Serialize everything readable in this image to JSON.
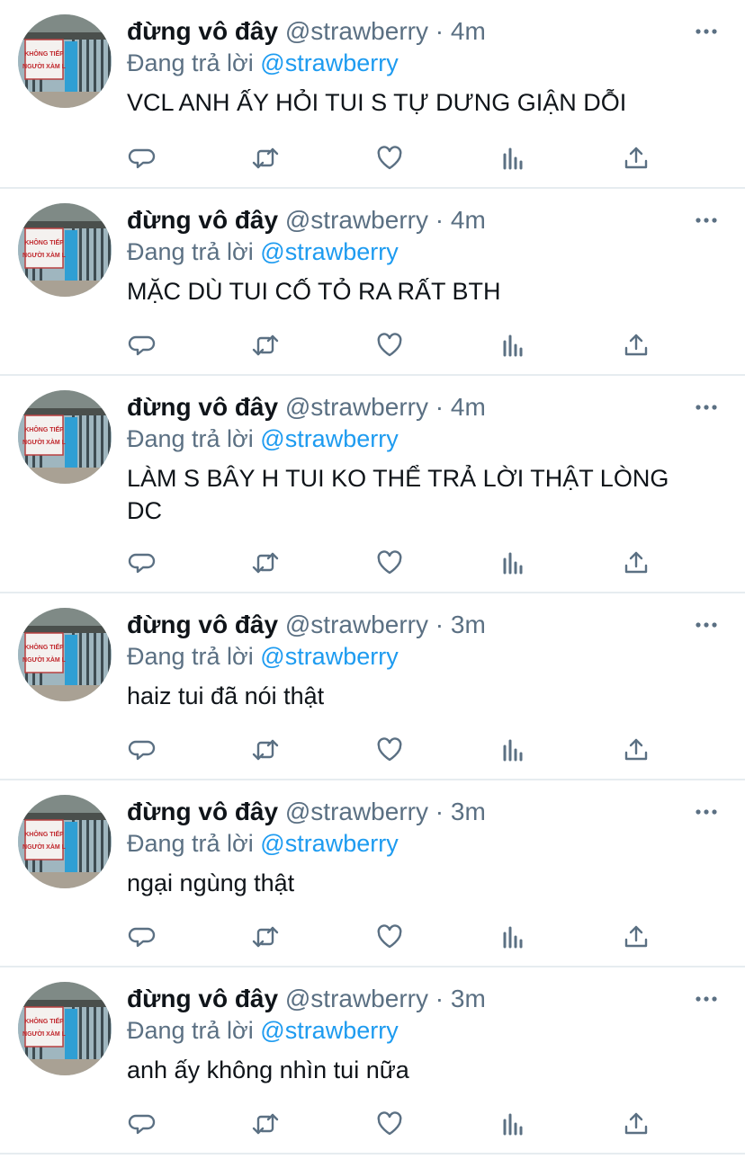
{
  "tweets": [
    {
      "name": "đừng vô đây",
      "handle": "@strawberry",
      "sep": "·",
      "time": "4m",
      "reply_prefix": "Đang trả lời",
      "reply_to": "@strawberry",
      "text": "VCL ANH ẤY HỎI TUI S TỰ DƯNG GIẬN DỖI"
    },
    {
      "name": "đừng vô đây",
      "handle": "@strawberry",
      "sep": "·",
      "time": "4m",
      "reply_prefix": "Đang trả lời",
      "reply_to": "@strawberry",
      "text": "MẶC DÙ TUI CỐ TỎ RA RẤT BTH"
    },
    {
      "name": "đừng vô đây",
      "handle": "@strawberry",
      "sep": "·",
      "time": "4m",
      "reply_prefix": "Đang trả lời",
      "reply_to": "@strawberry",
      "text": "LÀM S BÂY H TUI KO THỂ TRẢ LỜI THẬT LÒNG DC"
    },
    {
      "name": "đừng vô đây",
      "handle": "@strawberry",
      "sep": "·",
      "time": "3m",
      "reply_prefix": "Đang trả lời",
      "reply_to": "@strawberry",
      "text": "haiz tui đã nói thật"
    },
    {
      "name": "đừng vô đây",
      "handle": "@strawberry",
      "sep": "·",
      "time": "3m",
      "reply_prefix": "Đang trả lời",
      "reply_to": "@strawberry",
      "text": "ngại ngùng thật"
    },
    {
      "name": "đừng vô đây",
      "handle": "@strawberry",
      "sep": "·",
      "time": "3m",
      "reply_prefix": "Đang trả lời",
      "reply_to": "@strawberry",
      "text": "anh ấy không nhìn tui nữa"
    }
  ],
  "avatar_sign": {
    "line1": "KHÔNG TIẾP",
    "line2": "NGƯỜI XÀM L"
  },
  "icons": [
    "reply-icon",
    "retweet-icon",
    "like-icon",
    "analytics-icon",
    "share-icon",
    "more-icon"
  ],
  "colors": {
    "mention": "#1d9bf0",
    "muted": "#5b7083",
    "text": "#0f1419",
    "divider": "#e6ecf0"
  }
}
